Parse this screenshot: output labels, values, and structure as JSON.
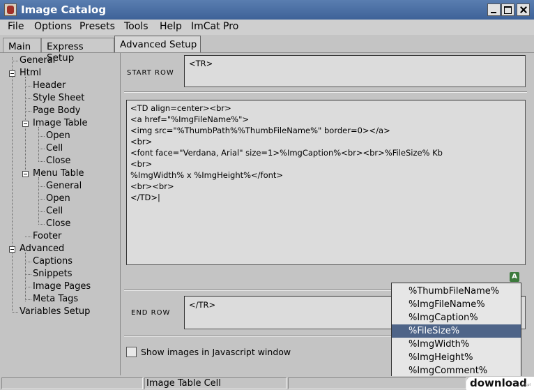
{
  "window": {
    "title": "Image Catalog"
  },
  "menu": [
    "File",
    "Options",
    "Presets",
    "Tools",
    "Help",
    "ImCat Pro"
  ],
  "tabs": [
    {
      "label": "Main",
      "active": false
    },
    {
      "label": "Express Setup",
      "active": false
    },
    {
      "label": "Advanced Setup",
      "active": true
    }
  ],
  "tree": [
    {
      "label": "General"
    },
    {
      "label": "Html"
    },
    {
      "label": "Header"
    },
    {
      "label": "Style Sheet"
    },
    {
      "label": "Page Body"
    },
    {
      "label": "Image Table"
    },
    {
      "label": "Open"
    },
    {
      "label": "Cell"
    },
    {
      "label": "Close"
    },
    {
      "label": "Menu Table"
    },
    {
      "label": "General"
    },
    {
      "label": "Open"
    },
    {
      "label": "Cell"
    },
    {
      "label": "Close"
    },
    {
      "label": "Footer"
    },
    {
      "label": "Advanced"
    },
    {
      "label": "Captions"
    },
    {
      "label": "Snippets"
    },
    {
      "label": "Image Pages"
    },
    {
      "label": "Meta Tags"
    },
    {
      "label": "Variables Setup"
    }
  ],
  "start_row": {
    "label": "START ROW",
    "value": "<TR>"
  },
  "cell_code": [
    "<TD align=center><br>",
    "<a href=\"%ImgFileName%\">",
    "<img src=\"%ThumbPath%%ThumbFileName%\" border=0></a>",
    "<br>",
    "<font face=\"Verdana, Arial\" size=1>%ImgCaption%<br><br>%FileSize% Kb",
    "<br>",
    "%ImgWidth% x %ImgHeight%</font>",
    "<br><br>",
    "</TD>|"
  ],
  "end_row": {
    "label": "END ROW",
    "value": "</TR>"
  },
  "javascript_option": {
    "label": "Show images in Javascript window",
    "checked": false
  },
  "insert_icon": {
    "name": "insert-variable-icon",
    "glyph": "A"
  },
  "variables_popup": {
    "items": [
      "%ThumbFileName%",
      "%ImgFileName%",
      "%ImgCaption%",
      "%FileSize%",
      "%ImgWidth%",
      "%ImgHeight%",
      "%ImgComment%"
    ],
    "selected": "%FileSize%"
  },
  "status": {
    "text": "Image Table Cell"
  },
  "watermark": {
    "text": "download",
    "sub": ".net.pl"
  },
  "colors": {
    "titlebar": "#4a6ea4",
    "selection": "#4e6488",
    "panel": "#c4c4c4"
  }
}
